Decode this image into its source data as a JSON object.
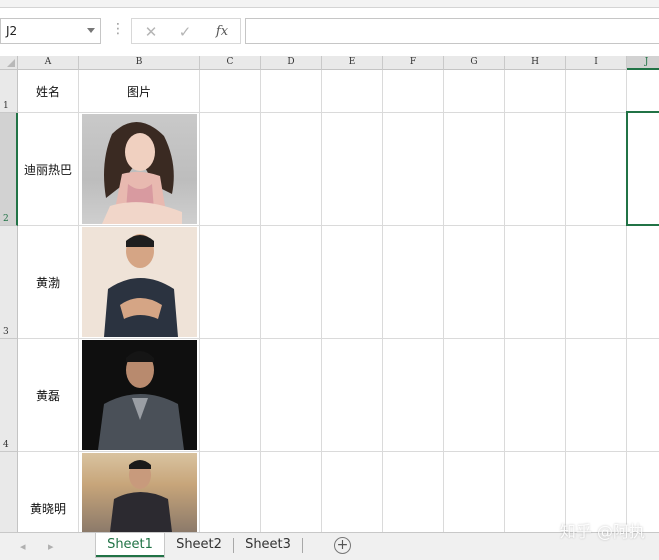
{
  "formula_bar": {
    "name_box": "J2",
    "cancel_icon": "close-icon",
    "enter_icon": "check-icon",
    "fx_label": "fx",
    "formula_value": ""
  },
  "columns": [
    "A",
    "B",
    "C",
    "D",
    "E",
    "F",
    "G",
    "H",
    "I",
    "J"
  ],
  "rows": [
    "1",
    "2",
    "3",
    "4"
  ],
  "cells": {
    "A1": "姓名",
    "B1": "图片",
    "A2": "迪丽热巴",
    "A3": "黄渤",
    "A4": "黄磊",
    "A5": "黄晓明"
  },
  "sheets": [
    "Sheet1",
    "Sheet2",
    "Sheet3"
  ],
  "active_sheet": "Sheet1",
  "watermark": "知乎 @阿执",
  "colors": {
    "accent": "#217346",
    "grid": "#dadada",
    "header_bg": "#e9e9e9"
  }
}
